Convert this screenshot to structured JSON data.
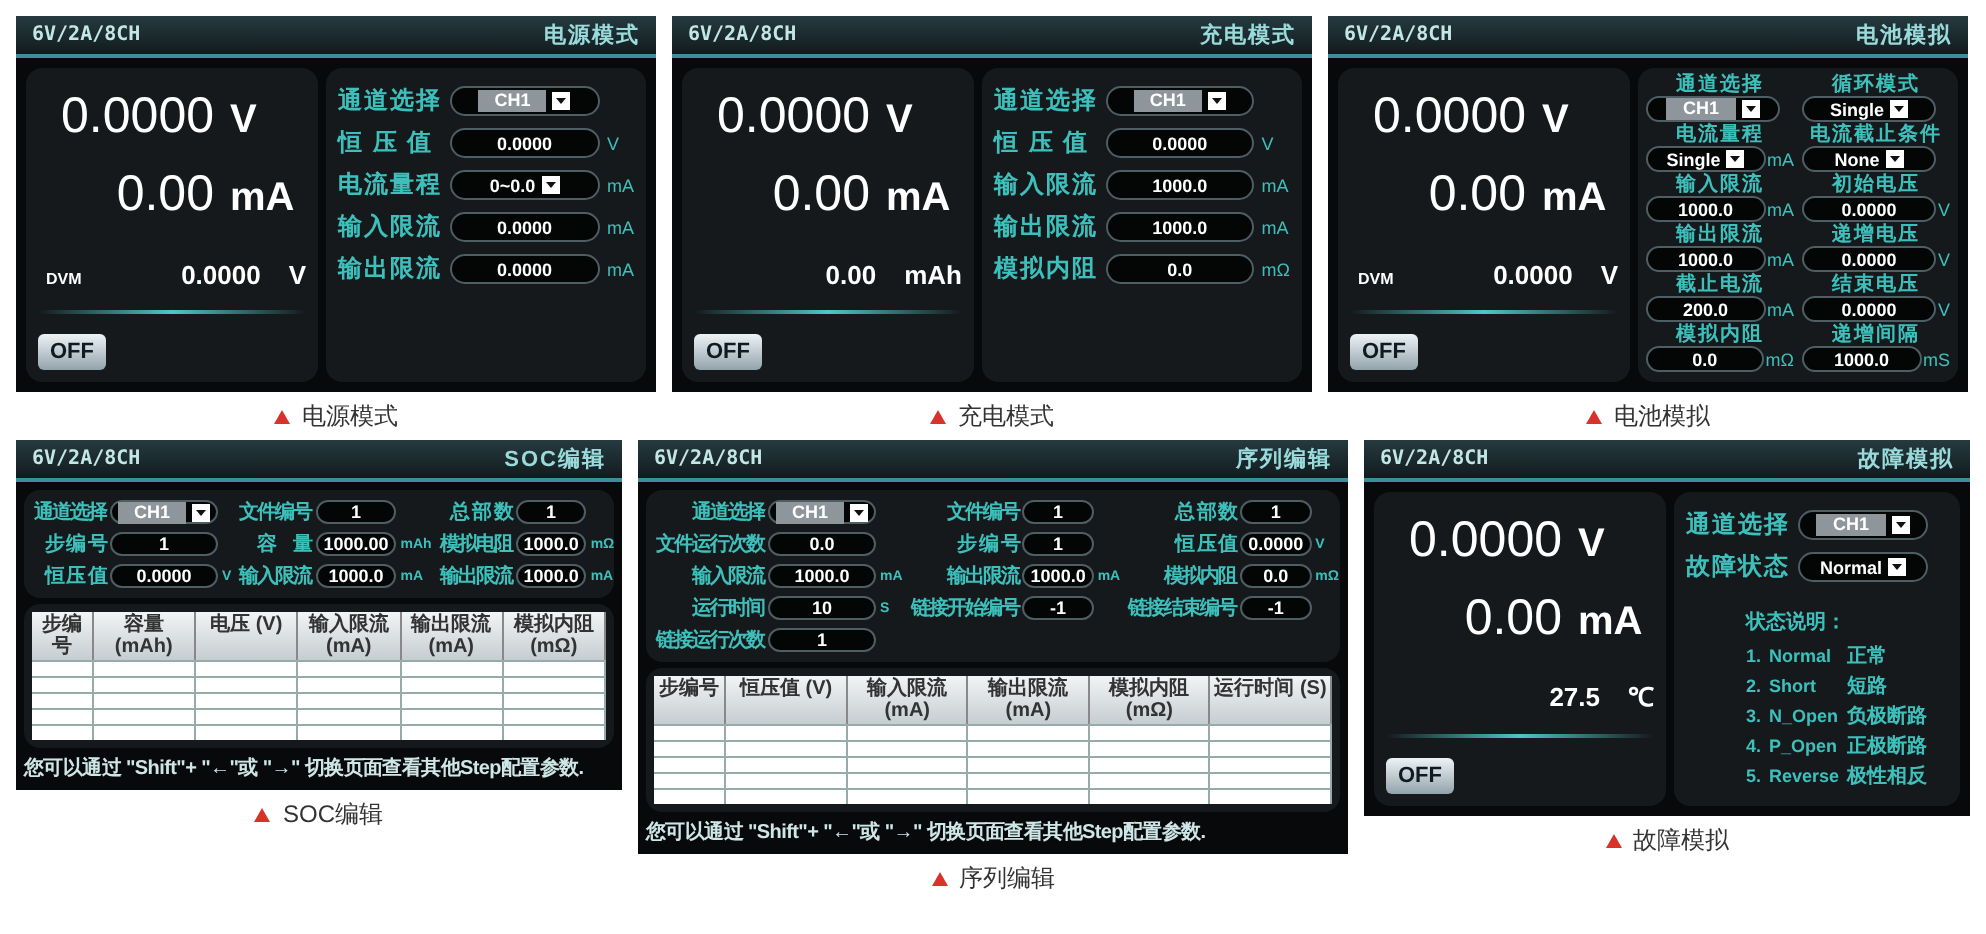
{
  "screens": [
    {
      "kind": "monitor",
      "model": "6V/2A/8CH",
      "mode": "电源模式",
      "readings": [
        {
          "value": "0.0000",
          "unit": "V"
        },
        {
          "value": "0.00",
          "unit": "mA"
        }
      ],
      "extra": {
        "label": "DVM",
        "value": "0.0000",
        "unit": "V"
      },
      "output_button": "OFF",
      "form": {
        "fields": [
          {
            "label": "通道选择",
            "kind": "select",
            "value": "CH1",
            "highlighted": true
          },
          {
            "label": "恒 压 值",
            "kind": "input",
            "value": "0.0000",
            "unit": "V"
          },
          {
            "label": "电流量程",
            "kind": "select",
            "value": "0~0.0",
            "unit": "mA",
            "highlighted": false
          },
          {
            "label": "输入限流",
            "kind": "input",
            "value": "0.0000",
            "unit": "mA"
          },
          {
            "label": "输出限流",
            "kind": "input",
            "value": "0.0000",
            "unit": "mA"
          }
        ]
      },
      "caption": "电源模式"
    },
    {
      "kind": "monitor",
      "model": "6V/2A/8CH",
      "mode": "充电模式",
      "readings": [
        {
          "value": "0.0000",
          "unit": "V"
        },
        {
          "value": "0.00",
          "unit": "mA"
        }
      ],
      "extra": {
        "value": "0.00",
        "unit": "mAh"
      },
      "output_button": "OFF",
      "form": {
        "fields": [
          {
            "label": "通道选择",
            "kind": "select",
            "value": "CH1",
            "highlighted": true
          },
          {
            "label": "恒 压 值",
            "kind": "input",
            "value": "0.0000",
            "unit": "V"
          },
          {
            "label": "输入限流",
            "kind": "input",
            "value": "1000.0",
            "unit": "mA"
          },
          {
            "label": "输出限流",
            "kind": "input",
            "value": "1000.0",
            "unit": "mA"
          },
          {
            "label": "模拟内阻",
            "kind": "input",
            "value": "0.0",
            "unit": "mΩ"
          }
        ]
      },
      "caption": "充电模式"
    },
    {
      "kind": "battery",
      "model": "6V/2A/8CH",
      "mode": "电池模拟",
      "readings": [
        {
          "value": "0.0000",
          "unit": "V"
        },
        {
          "value": "0.00",
          "unit": "mA"
        }
      ],
      "extra": {
        "label": "DVM",
        "value": "0.0000",
        "unit": "V"
      },
      "output_button": "OFF",
      "form": {
        "fields": [
          {
            "label": "通道选择",
            "kind": "select",
            "value": "CH1",
            "highlighted": true
          },
          {
            "label": "循环模式",
            "kind": "select",
            "value": "Single",
            "highlighted": false
          },
          {
            "label": "电流量程",
            "kind": "select",
            "value": "Single",
            "unit": "mA",
            "highlighted": false
          },
          {
            "label": "电流截止条件",
            "kind": "select",
            "value": "None",
            "highlighted": false
          },
          {
            "label": "输入限流",
            "kind": "input",
            "value": "1000.0",
            "unit": "mA"
          },
          {
            "label": "初始电压",
            "kind": "input",
            "value": "0.0000",
            "unit": "V"
          },
          {
            "label": "输出限流",
            "kind": "input",
            "value": "1000.0",
            "unit": "mA"
          },
          {
            "label": "递增电压",
            "kind": "input",
            "value": "0.0000",
            "unit": "V"
          },
          {
            "label": "截止电流",
            "kind": "input",
            "value": "200.0",
            "unit": "mA"
          },
          {
            "label": "结束电压",
            "kind": "input",
            "value": "0.0000",
            "unit": "V"
          },
          {
            "label": "模拟内阻",
            "kind": "input",
            "value": "0.0",
            "unit": "mΩ"
          },
          {
            "label": "递增间隔",
            "kind": "input",
            "value": "1000.0",
            "unit": "mS"
          }
        ]
      },
      "caption": "电池模拟"
    },
    {
      "kind": "editor",
      "model": "6V/2A/8CH",
      "mode": "SOC编辑",
      "form": {
        "fields": [
          {
            "label": "通道选择",
            "kind": "select",
            "value": "CH1",
            "highlighted": true
          },
          {
            "label": "文件编号",
            "kind": "input",
            "value": "1"
          },
          {
            "label": "总 部 数",
            "kind": "input",
            "value": "1"
          },
          {
            "label": "步 编 号",
            "kind": "input",
            "value": "1"
          },
          {
            "label": "容　量",
            "kind": "input",
            "value": "1000.00",
            "unit": "mAh"
          },
          {
            "label": "模拟电阻",
            "kind": "input",
            "value": "1000.0",
            "unit": "mΩ"
          },
          {
            "label": "恒 压 值",
            "kind": "input",
            "value": "0.0000",
            "unit": "V"
          },
          {
            "label": "输入限流",
            "kind": "input",
            "value": "1000.0",
            "unit": "mA"
          },
          {
            "label": "输出限流",
            "kind": "input",
            "value": "1000.0",
            "unit": "mA"
          }
        ]
      },
      "table": {
        "columns": [
          "步编号",
          "容量 (mAh)",
          "电压 (V)",
          "输入限流 (mA)",
          "输出限流 (mA)",
          "模拟内阻 (mΩ)"
        ]
      },
      "hint": "您可以通过 \"Shift\"+ \"←\"或 \"→\" 切换页面查看其他Step配置参数.",
      "caption": "SOC编辑"
    },
    {
      "kind": "editor",
      "model": "6V/2A/8CH",
      "mode": "序列编辑",
      "form": {
        "fields": [
          {
            "label": "通道选择",
            "kind": "select",
            "value": "CH1",
            "highlighted": true
          },
          {
            "label": "文件编号",
            "kind": "input",
            "value": "1"
          },
          {
            "label": "总 部 数",
            "kind": "input",
            "value": "1"
          },
          {
            "label": "文件运行次数",
            "kind": "input",
            "value": "0.0"
          },
          {
            "label": "步 编 号",
            "kind": "input",
            "value": "1"
          },
          {
            "label": "恒 压 值",
            "kind": "input",
            "value": "0.0000",
            "unit": "V"
          },
          {
            "label": "输入限流",
            "kind": "input",
            "value": "1000.0",
            "unit": "mA"
          },
          {
            "label": "输出限流",
            "kind": "input",
            "value": "1000.0",
            "unit": "mA"
          },
          {
            "label": "模拟内阻",
            "kind": "input",
            "value": "0.0",
            "unit": "mΩ"
          },
          {
            "label": "运行时间",
            "kind": "input",
            "value": "10",
            "unit": "S"
          },
          {
            "label": "链接开始编号",
            "kind": "input",
            "value": "-1"
          },
          {
            "label": "链接结束编号",
            "kind": "input",
            "value": "-1"
          },
          {
            "label": "链接运行次数",
            "kind": "input",
            "value": "1"
          }
        ]
      },
      "table": {
        "columns": [
          "步编号",
          "恒压值 (V)",
          "输入限流 (mA)",
          "输出限流 (mA)",
          "模拟内阻 (mΩ)",
          "运行时间 (S)"
        ]
      },
      "hint": "您可以通过 \"Shift\"+ \"←\"或 \"→\" 切换页面查看其他Step配置参数.",
      "caption": "序列编辑"
    },
    {
      "kind": "monitor",
      "model": "6V/2A/8CH",
      "mode": "故障模拟",
      "readings": [
        {
          "value": "0.0000",
          "unit": "V"
        },
        {
          "value": "0.00",
          "unit": "mA"
        }
      ],
      "extra": {
        "value": "27.5",
        "unit": "℃"
      },
      "output_button": "OFF",
      "form": {
        "fields": [
          {
            "label": "通道选择",
            "kind": "select",
            "value": "CH1",
            "highlighted": true
          },
          {
            "label": "故障状态",
            "kind": "select",
            "value": "Normal",
            "highlighted": false
          }
        ]
      },
      "notes": {
        "title": "状态说明：",
        "items": [
          {
            "number": "1.",
            "name": "Normal",
            "meaning": "正常"
          },
          {
            "number": "2.",
            "name": "Short",
            "meaning": "短路"
          },
          {
            "number": "3.",
            "name": "N_Open",
            "meaning": "负极断路"
          },
          {
            "number": "4.",
            "name": "P_Open",
            "meaning": "正极断路"
          },
          {
            "number": "5.",
            "name": "Reverse",
            "meaning": "极性相反"
          }
        ]
      },
      "caption": "故障模拟"
    }
  ]
}
